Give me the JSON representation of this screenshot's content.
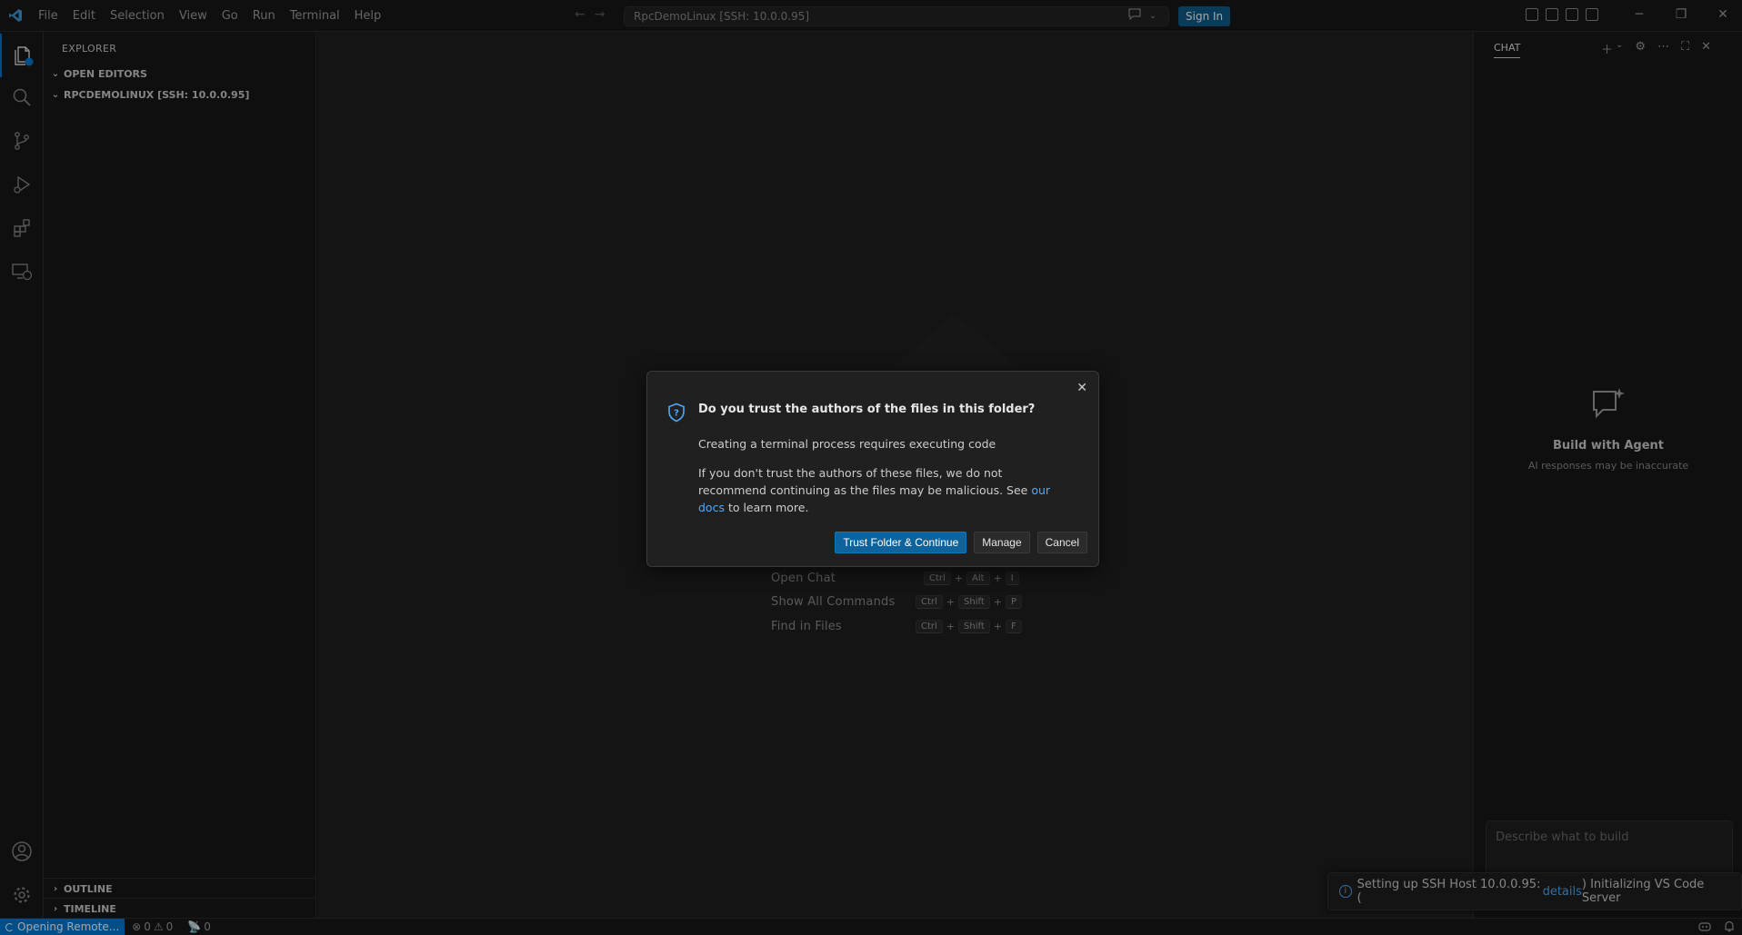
{
  "titlebar": {
    "menu": [
      "File",
      "Edit",
      "Selection",
      "View",
      "Go",
      "Run",
      "Terminal",
      "Help"
    ],
    "command_center": "RpcDemoLinux [SSH: 10.0.0.95]",
    "sign_in": "Sign In"
  },
  "sidebar": {
    "title": "EXPLORER",
    "open_editors": "OPEN EDITORS",
    "folder": "RPCDEMOLINUX [SSH: 10.0.0.95]",
    "outline": "OUTLINE",
    "timeline": "TIMELINE"
  },
  "editor": {
    "shortcuts": [
      {
        "label": "Open Chat",
        "keys": [
          "Ctrl",
          "Alt",
          "I"
        ]
      },
      {
        "label": "Show All Commands",
        "keys": [
          "Ctrl",
          "Shift",
          "P"
        ]
      },
      {
        "label": "Find in Files",
        "keys": [
          "Ctrl",
          "Shift",
          "F"
        ]
      }
    ]
  },
  "chat": {
    "tab": "CHAT",
    "hero_title": "Build with Agent",
    "hero_subtitle": "AI responses may be inaccurate",
    "input_placeholder": "Describe what to build"
  },
  "notification": {
    "prefix": "Setting up SSH Host 10.0.0.95: (",
    "link": "details",
    "suffix": ") Initializing VS Code Server"
  },
  "statusbar": {
    "remote": "Opening Remote...",
    "errors": "0",
    "warnings": "0",
    "ports": "0"
  },
  "dialog": {
    "title": "Do you trust the authors of the files in this folder?",
    "message": "Creating a terminal process requires executing code",
    "detail_before": "If you don't trust the authors of these files, we do not recommend continuing as the files may be malicious. See ",
    "detail_link": "our docs",
    "detail_after": " to learn more.",
    "buttons": {
      "trust": "Trust Folder & Continue",
      "manage": "Manage",
      "cancel": "Cancel"
    }
  },
  "colors": {
    "accent": "#0078d4",
    "primary_button": "#0e639c",
    "link": "#4daafc"
  }
}
